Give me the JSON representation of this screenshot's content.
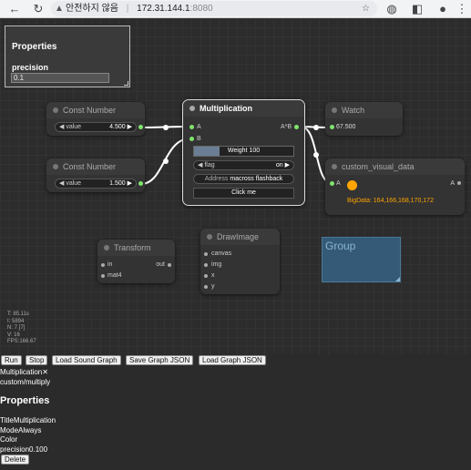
{
  "browser": {
    "security_label": "안전하지 않음",
    "url_host": "172.31.144.1",
    "url_port": ":8080"
  },
  "overlay": {
    "title": "Properties",
    "prop_label": "precision",
    "prop_value": "0.1"
  },
  "nodes": {
    "const1": {
      "title": "Const Number",
      "widget_label": "value",
      "widget_value": "4.500"
    },
    "const2": {
      "title": "Const Number",
      "widget_label": "value",
      "widget_value": "1.500"
    },
    "mult": {
      "title": "Multiplication",
      "in_a": "A",
      "in_b": "B",
      "out": "A*B",
      "weight_label": "Weight",
      "weight_value": "100",
      "flag_label": "flag",
      "flag_value": "on",
      "address_label": "Address",
      "address_value": "macross flashback",
      "click_label": "Click me"
    },
    "watch": {
      "title": "Watch",
      "value": "67.500"
    },
    "custom": {
      "title": "custom_visual_data",
      "in_a": "A",
      "out_a": "A",
      "bigdata": "BigData: 164,166,168,170,172"
    },
    "transform": {
      "title": "Transform",
      "in": "in",
      "out": "out",
      "in2": "mat4"
    },
    "drawimage": {
      "title": "DrawImage",
      "s1": "canvas",
      "s2": "img",
      "s3": "x",
      "s4": "y"
    }
  },
  "group": {
    "title": "Group"
  },
  "stats": {
    "t": "T: 85.11s",
    "i": "I: 5894",
    "n": "N: 7 [7]",
    "v": "V: 16",
    "fps": "FPS:166.67"
  },
  "controls": {
    "run": "Run",
    "stop": "Stop",
    "load_sound": "Load Sound Graph",
    "save_json": "Save Graph JSON",
    "load_json": "Load Graph JSON",
    "selected": "Multiplication✕",
    "type": "custom/multiply",
    "panel_title": "Properties",
    "title_row": "TitleMultiplication",
    "mode_row": "ModeAlways",
    "color_row": "Color",
    "precision_row": "precision0.100",
    "delete": "Delete"
  },
  "colors": {
    "link": "#ffffff",
    "slot_connected": "#7fe56b",
    "group": "#345a77",
    "bigdata": "#ffa500"
  }
}
